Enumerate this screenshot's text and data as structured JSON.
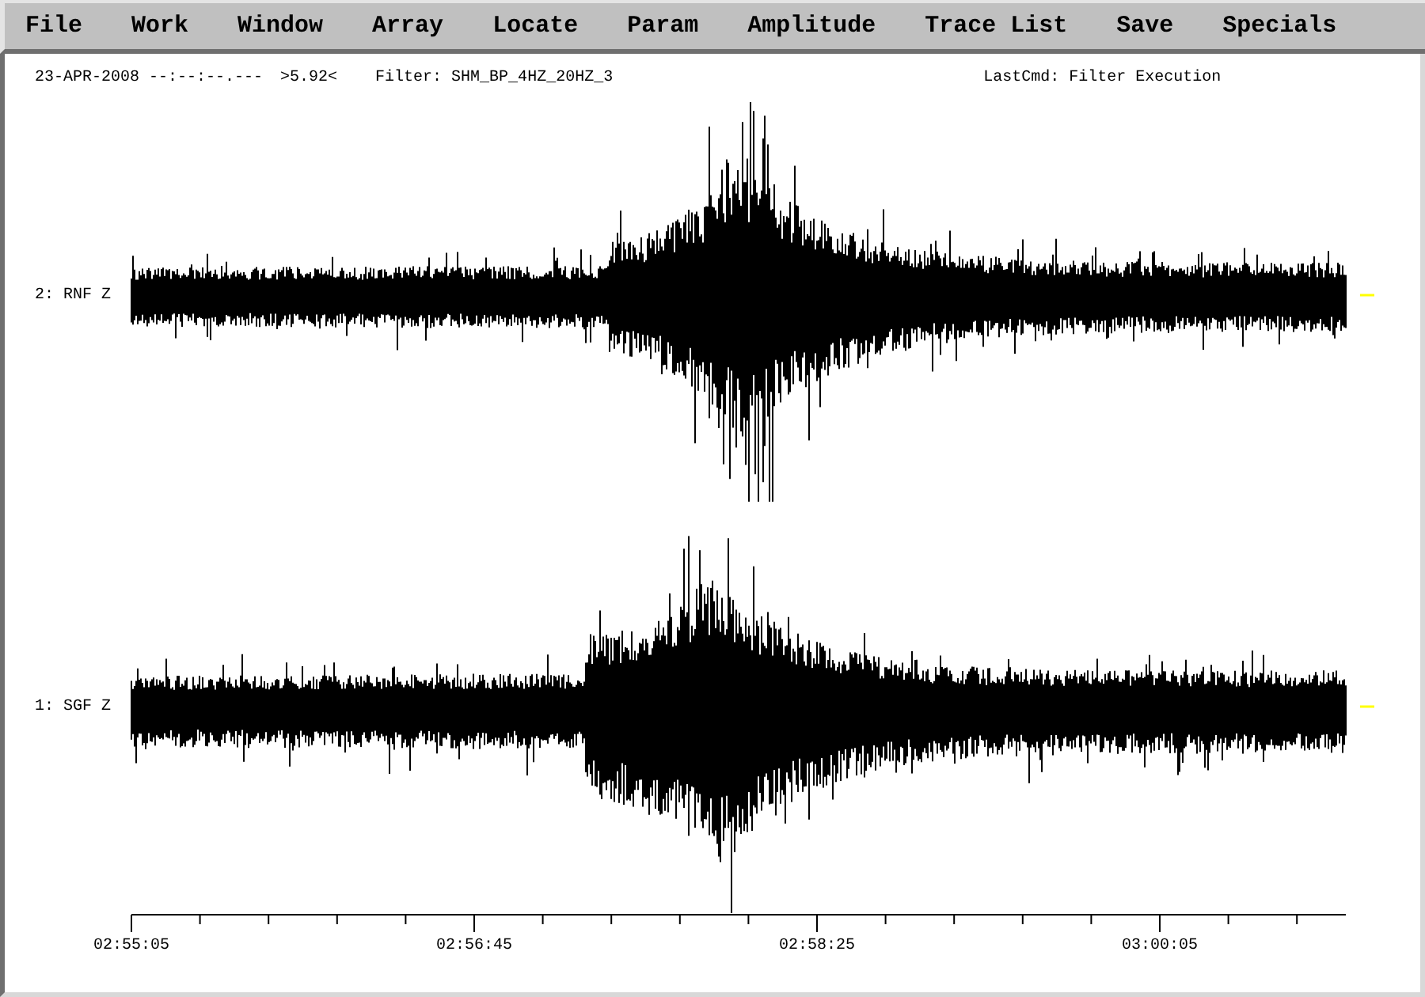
{
  "menu_bar": {
    "items": [
      "File",
      "Work",
      "Window",
      "Array",
      "Locate",
      "Param",
      "Amplitude",
      "Trace List",
      "Save",
      "Specials"
    ]
  },
  "status_line": {
    "date_time": "23-APR-2008 --:--:--.---",
    "scale": ">5.92<",
    "filter": "Filter: SHM_BP_4HZ_20HZ_3",
    "last_command": "LastCmd: Filter Execution"
  },
  "traces": [
    {
      "label": "2: RNF Z"
    },
    {
      "label": "1: SGF Z"
    }
  ],
  "time_axis": {
    "labels": [
      "02:55:05",
      "02:56:45",
      "02:58:25",
      "03:00:05"
    ]
  }
}
